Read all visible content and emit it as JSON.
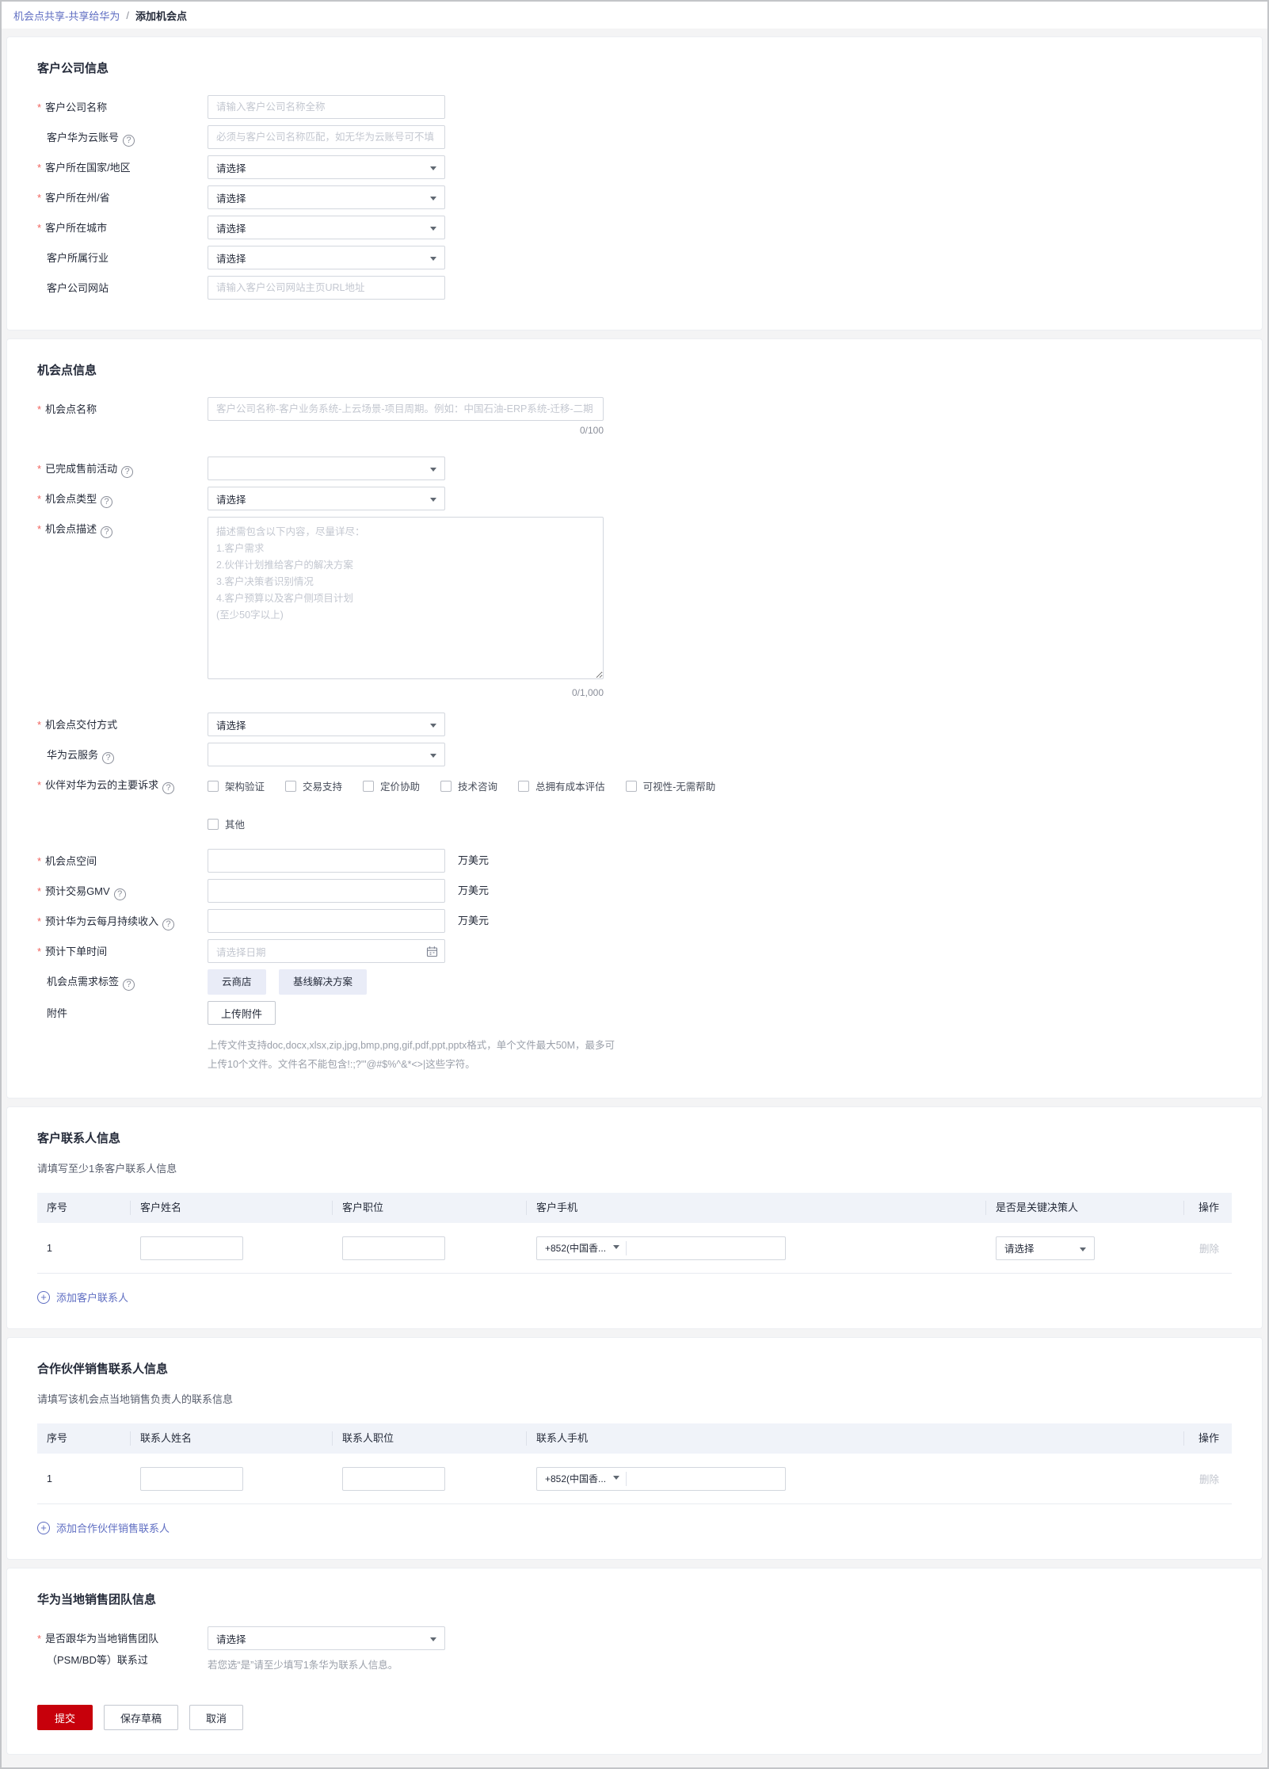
{
  "colors": {
    "accent_red": "#c7000b",
    "link_blue": "#5f6ec2"
  },
  "breadcrumb": {
    "parent": "机会点共享-共享给华为",
    "separator": "/",
    "current": "添加机会点"
  },
  "company": {
    "title": "客户公司信息",
    "name": {
      "label": "客户公司名称",
      "placeholder": "请输入客户公司名称全称"
    },
    "account": {
      "label": "客户华为云账号",
      "placeholder": "必须与客户公司名称匹配，如无华为云账号可不填"
    },
    "country": {
      "label": "客户所在国家/地区",
      "value": "请选择"
    },
    "state": {
      "label": "客户所在州/省",
      "value": "请选择"
    },
    "city": {
      "label": "客户所在城市",
      "value": "请选择"
    },
    "industry": {
      "label": "客户所属行业",
      "value": "请选择"
    },
    "website": {
      "label": "客户公司网站",
      "placeholder": "请输入客户公司网站主页URL地址"
    }
  },
  "opportunity": {
    "title": "机会点信息",
    "name": {
      "label": "机会点名称",
      "placeholder": "客户公司名称-客户业务系统-上云场景-项目周期。例如：中国石油-ERP系统-迁移-二期",
      "counter": "0/100"
    },
    "presales": {
      "label": "已完成售前活动",
      "value": ""
    },
    "type": {
      "label": "机会点类型",
      "value": "请选择"
    },
    "description": {
      "label": "机会点描述",
      "placeholder": "描述需包含以下内容，尽量详尽：\n1.客户需求\n2.伙伴计划推给客户的解决方案\n3.客户决策者识别情况\n4.客户预算以及客户侧项目计划\n(至少50字以上)",
      "counter": "0/1,000"
    },
    "delivery": {
      "label": "机会点交付方式",
      "value": "请选择"
    },
    "hwc_service": {
      "label": "华为云服务",
      "value": ""
    },
    "appeal": {
      "label": "伙伴对华为云的主要诉求",
      "options_row1": [
        "架构验证",
        "交易支持",
        "定价协助",
        "技术咨询",
        "总拥有成本评估",
        "可视性-无需帮助"
      ],
      "options_row2": [
        "其他"
      ]
    },
    "space": {
      "label": "机会点空间",
      "unit": "万美元"
    },
    "gmv": {
      "label": "预计交易GMV",
      "unit": "万美元"
    },
    "mrr": {
      "label": "预计华为云每月持续收入",
      "unit": "万美元"
    },
    "order_date": {
      "label": "预计下单时间",
      "placeholder": "请选择日期"
    },
    "tags": {
      "label": "机会点需求标签",
      "items": [
        "云商店",
        "基线解决方案"
      ]
    },
    "attachment": {
      "label": "附件",
      "button": "上传附件",
      "hint1": "上传文件支持doc,docx,xlsx,zip,jpg,bmp,png,gif,pdf,ppt,pptx格式，单个文件最大50M，最多可",
      "hint2": "上传10个文件。文件名不能包含!:;?'\"@#$%^&*<>|这些字符。"
    }
  },
  "customer_contacts": {
    "title": "客户联系人信息",
    "subtitle": "请填写至少1条客户联系人信息",
    "headers": [
      "序号",
      "客户姓名",
      "客户职位",
      "客户手机",
      "是否是关键决策人",
      "操作"
    ],
    "row": {
      "index": "1",
      "phone_prefix": "+852(中国香...",
      "decision_value": "请选择",
      "action": "删除"
    },
    "add_label": "添加客户联系人"
  },
  "partner_contacts": {
    "title": "合作伙伴销售联系人信息",
    "subtitle": "请填写该机会点当地销售负责人的联系信息",
    "headers": [
      "序号",
      "联系人姓名",
      "联系人职位",
      "联系人手机",
      "操作"
    ],
    "row": {
      "index": "1",
      "phone_prefix": "+852(中国香...",
      "action": "删除"
    },
    "add_label": "添加合作伙伴销售联系人"
  },
  "huawei_team": {
    "title": "华为当地销售团队信息",
    "contacted": {
      "label_line1": "是否跟华为当地销售团队",
      "label_line2": "（PSM/BD等）联系过",
      "value": "请选择",
      "hint": "若您选“是”请至少填写1条华为联系人信息。"
    }
  },
  "footer": {
    "submit": "提交",
    "save_draft": "保存草稿",
    "cancel": "取消"
  }
}
